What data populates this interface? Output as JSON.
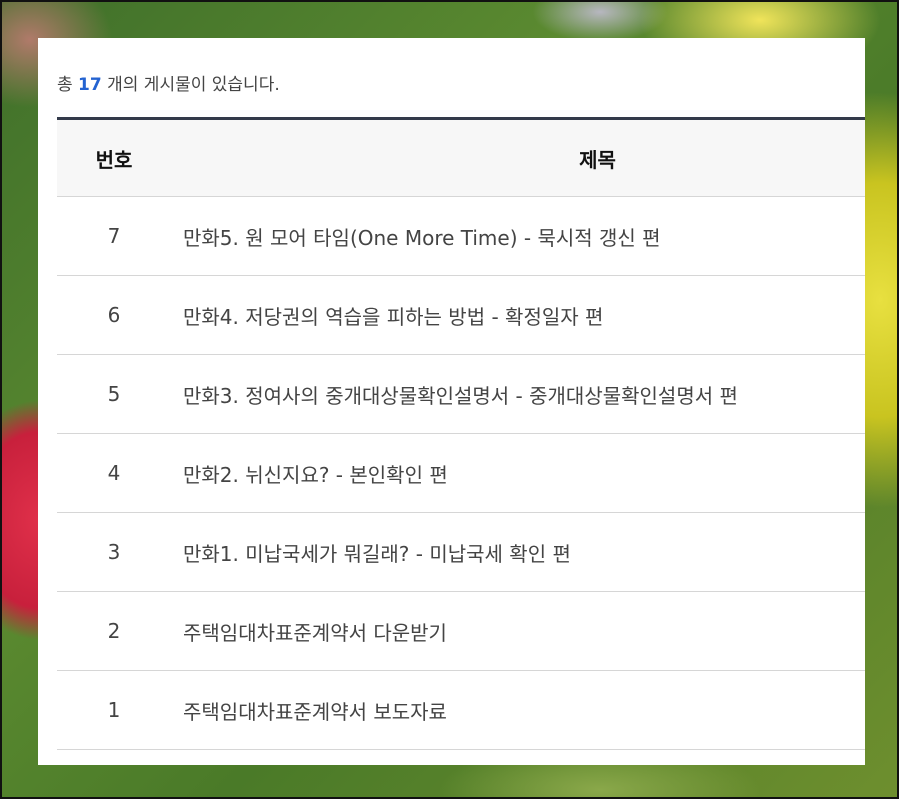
{
  "summary": {
    "prefix": "총",
    "count": "17",
    "suffix": "개의 게시물이 있습니다."
  },
  "table": {
    "headers": {
      "number": "번호",
      "title": "제목"
    },
    "rows": [
      {
        "number": "7",
        "title": "만화5. 원 모어 타임(One More Time) - 묵시적 갱신 편"
      },
      {
        "number": "6",
        "title": "만화4. 저당권의 역습을 피하는 방법 - 확정일자 편"
      },
      {
        "number": "5",
        "title": "만화3. 정여사의 중개대상물확인설명서 - 중개대상물확인설명서 편"
      },
      {
        "number": "4",
        "title": "만화2. 뉘신지요? - 본인확인 편"
      },
      {
        "number": "3",
        "title": "만화1. 미납국세가 뭐길래? - 미납국세 확인 편"
      },
      {
        "number": "2",
        "title": "주택임대차표준계약서 다운받기"
      },
      {
        "number": "1",
        "title": "주택임대차표준계약서 보도자료"
      }
    ]
  },
  "colors": {
    "accent": "#2463d1",
    "table_top_border": "#333a4a",
    "header_bg": "#f7f7f7"
  }
}
